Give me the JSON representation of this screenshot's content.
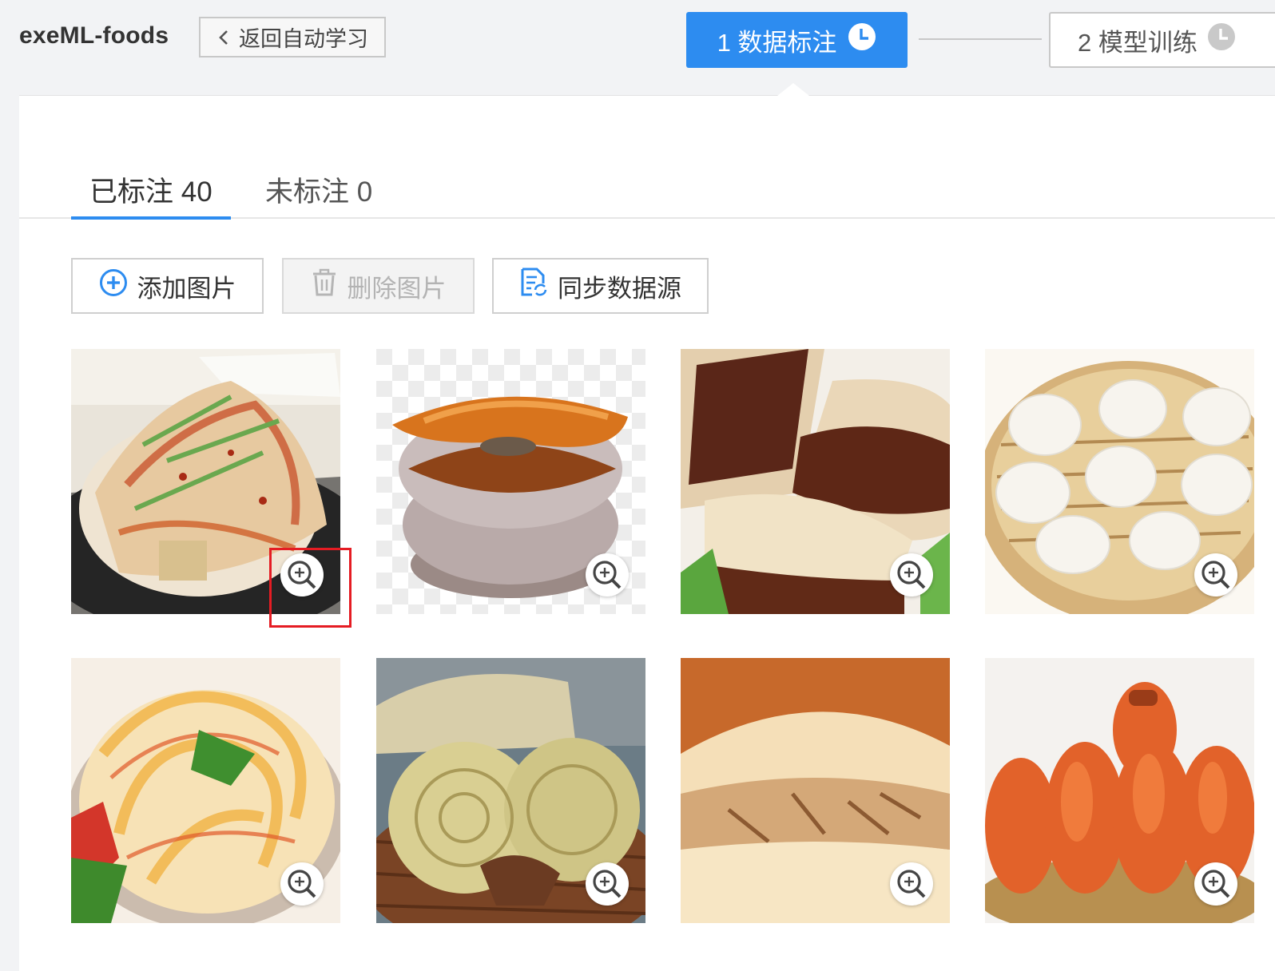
{
  "header": {
    "app_title": "exeML-foods",
    "back_label": "返回自动学习",
    "steps": [
      {
        "label": "1 数据标注",
        "active": true
      },
      {
        "label": "2 模型训练",
        "active": false
      }
    ]
  },
  "tabs": [
    {
      "label": "已标注 40",
      "active": true
    },
    {
      "label": "未标注 0",
      "active": false
    }
  ],
  "toolbar": {
    "add_label": "添加图片",
    "delete_label": "删除图片",
    "sync_label": "同步数据源"
  },
  "images": [
    {
      "name": "image-card-noodles-spicy",
      "food": "liangpi-noodles"
    },
    {
      "name": "image-card-persimmon-cake",
      "food": "persimmon-cake"
    },
    {
      "name": "image-card-roujiamo",
      "food": "roujiamo"
    },
    {
      "name": "image-card-steamed-buns",
      "food": "soup-dumplings"
    },
    {
      "name": "image-card-biangbiang-noodles",
      "food": "biangbiang-noodles"
    },
    {
      "name": "image-card-flatbread-basket",
      "food": "flatbread"
    },
    {
      "name": "image-card-roujiamo-closeup",
      "food": "roujiamo"
    },
    {
      "name": "image-card-dried-persimmons",
      "food": "dried-persimmons"
    }
  ],
  "colors": {
    "accent": "#2d8cf0",
    "highlight": "#e51c23"
  },
  "icons": {
    "zoom": "zoom-in-icon",
    "add": "plus-circle-icon",
    "delete": "trash-icon",
    "sync": "sync-document-icon",
    "clock": "clock-icon"
  }
}
